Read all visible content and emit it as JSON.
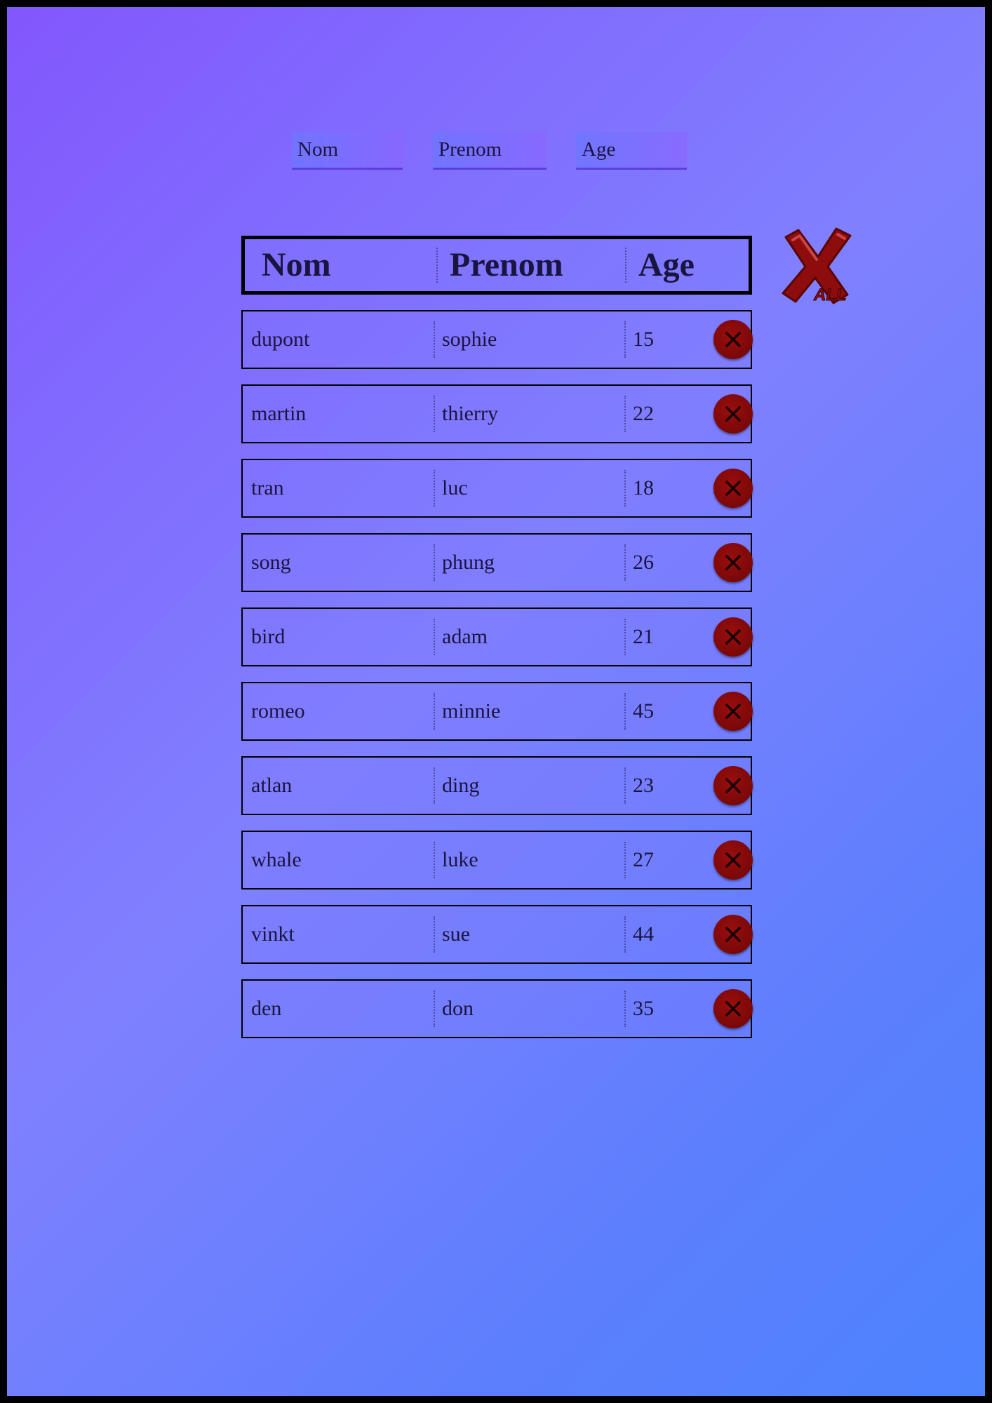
{
  "form": {
    "nom_placeholder": "Nom",
    "prenom_placeholder": "Prenom",
    "age_placeholder": "Age"
  },
  "table": {
    "headers": [
      "Nom",
      "Prenom",
      "Age"
    ],
    "delete_all_label": "ALL",
    "rows": [
      {
        "nom": "dupont",
        "prenom": "sophie",
        "age": "15"
      },
      {
        "nom": "martin",
        "prenom": "thierry",
        "age": "22"
      },
      {
        "nom": "tran",
        "prenom": "luc",
        "age": "18"
      },
      {
        "nom": "song",
        "prenom": "phung",
        "age": "26"
      },
      {
        "nom": "bird",
        "prenom": "adam",
        "age": "21"
      },
      {
        "nom": "romeo",
        "prenom": "minnie",
        "age": "45"
      },
      {
        "nom": "atlan",
        "prenom": "ding",
        "age": "23"
      },
      {
        "nom": "whale",
        "prenom": "luke",
        "age": "27"
      },
      {
        "nom": "vinkt",
        "prenom": "sue",
        "age": "44"
      },
      {
        "nom": "den",
        "prenom": "don",
        "age": "35"
      }
    ]
  },
  "colors": {
    "background_start": "#8257fd",
    "background_end": "#4d83fe",
    "delete_red": "#8a0b0b"
  },
  "icons": {
    "delete_all": "delete-all-icon",
    "delete_row": "close-circle-icon"
  }
}
